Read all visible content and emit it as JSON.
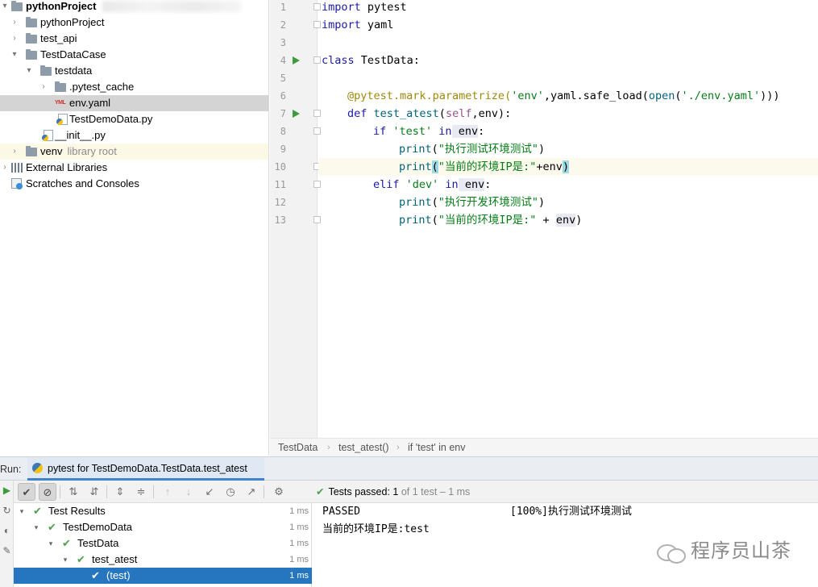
{
  "project": {
    "root_label": "pythonProject",
    "items": [
      {
        "label": "pythonProject"
      },
      {
        "label": "test_api"
      },
      {
        "label": "TestDataCase"
      },
      {
        "label": "testdata"
      },
      {
        "label": ".pytest_cache"
      },
      {
        "label": "env.yaml",
        "icon_text": "YML"
      },
      {
        "label": "TestDemoData.py"
      },
      {
        "label": "__init__.py"
      },
      {
        "label": "venv",
        "suffix": "library root"
      },
      {
        "label": "External Libraries"
      },
      {
        "label": "Scratches and Consoles"
      }
    ]
  },
  "editor": {
    "line_numbers": [
      "1",
      "2",
      "3",
      "4",
      "5",
      "6",
      "7",
      "8",
      "9",
      "10",
      "11",
      "12",
      "13"
    ],
    "code": {
      "l1": {
        "kw": "import",
        "rest": " pytest"
      },
      "l2": {
        "kw": "import",
        "rest": " yaml"
      },
      "l4": {
        "kw": "class",
        "rest": " TestData:"
      },
      "l6": {
        "dec": "@pytest.mark.parametrize(",
        "s1": "'env'",
        "mid": ",yaml.safe_load(",
        "open": "open",
        "p1": "(",
        "s2": "'./env.yaml'",
        "end": ")))"
      },
      "l7": {
        "kw": "def",
        "fn": " test_atest",
        "p1": "(",
        "self": "self",
        "rest": ",env):"
      },
      "l8": {
        "kw": "if",
        "s1": " 'test'",
        "kw2": " in",
        "hl": " env",
        "end": ":"
      },
      "l9": {
        "fn": "print",
        "p1": "(",
        "s1": "\"执行测试环境测试\"",
        "end": ")"
      },
      "l10": {
        "fn": "print",
        "b1": "(",
        "s1": "\"当前的环境IP是:\"",
        "op": "+env",
        "b2": ")"
      },
      "l11": {
        "kw": "elif",
        "s1": " 'dev'",
        "kw2": " in",
        "hl": " env",
        "end": ":"
      },
      "l12": {
        "fn": "print",
        "p1": "(",
        "s1": "\"执行开发环境测试\"",
        "end": ")"
      },
      "l13": {
        "fn": "print",
        "p1": "(",
        "s1": "\"当前的环境IP是:\"",
        "op": " + ",
        "hl": "env",
        "end": ")"
      }
    }
  },
  "breadcrumb": [
    "TestData",
    "test_atest()",
    "if 'test' in env"
  ],
  "run": {
    "label": "Run:",
    "tab_title": "pytest for TestDemoData.TestData.test_atest",
    "status": {
      "prefix": "Tests passed:",
      "count": "1",
      "suffix": "of 1 test – 1 ms"
    }
  },
  "test_tree": [
    {
      "label": "Test Results",
      "time": "1 ms"
    },
    {
      "label": "TestDemoData",
      "time": "1 ms"
    },
    {
      "label": "TestData",
      "time": "1 ms"
    },
    {
      "label": "test_atest",
      "time": "1 ms"
    },
    {
      "label": "(test)",
      "time": "1 ms"
    }
  ],
  "console": {
    "passed": "PASSED",
    "progress": "[100%]执行测试环境测试",
    "line2": "当前的环境IP是:test"
  },
  "watermark": {
    "text": "程序员山茶"
  },
  "colors": {
    "keyword": "#1a1aa6",
    "string": "#067d17",
    "decorator": "#9e880d",
    "pass": "#4fa04f",
    "selection": "#2675bf"
  }
}
